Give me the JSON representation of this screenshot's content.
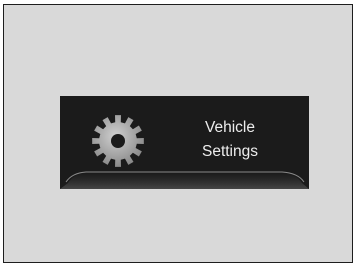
{
  "tile": {
    "icon": "gear-icon",
    "label_line1": "Vehicle",
    "label_line2": "Settings"
  },
  "colors": {
    "panel_background": "#d9d9d9",
    "display_background": "#1b1b1b",
    "text": "#ededed",
    "gear": "#a6a6a6",
    "accent_line": "#7a7a7a"
  }
}
